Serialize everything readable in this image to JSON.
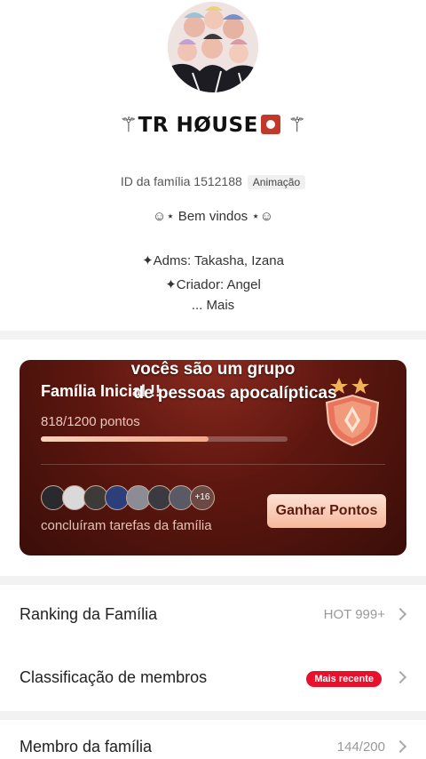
{
  "family": {
    "title": "⚚TR HØUSE",
    "title_end": "⚚",
    "id_text": "ID da família 1512188",
    "category_tag": "Animação",
    "description_lines": [
      "☺︎⋆ Bem vindos ⋆☺︎",
      "✦Adms: Takasha, Izana",
      "✦Criador: Angel"
    ],
    "more_label": "...  Mais"
  },
  "card": {
    "overlay_line1": "vocês são um grupo",
    "overlay_line2": "de pessoas apocalípticas",
    "title": "Família Inicial !!",
    "points_text": "818/1200 pontos",
    "progress_fraction": 0.68,
    "extra_members": "+16",
    "completed_text": "concluíram tarefas da família",
    "earn_button": "Ganhar Pontos"
  },
  "rows": {
    "ranking_label": "Ranking da Família",
    "ranking_value": "HOT 999+",
    "classification_label": "Classificação de membros",
    "classification_badge": "Mais recente",
    "members_label": "Membro da família",
    "members_value": "144/200"
  },
  "colors": {
    "card_bg": "#5e1710",
    "badge_red": "#e8102a",
    "button_peach": "#f6b89d"
  }
}
